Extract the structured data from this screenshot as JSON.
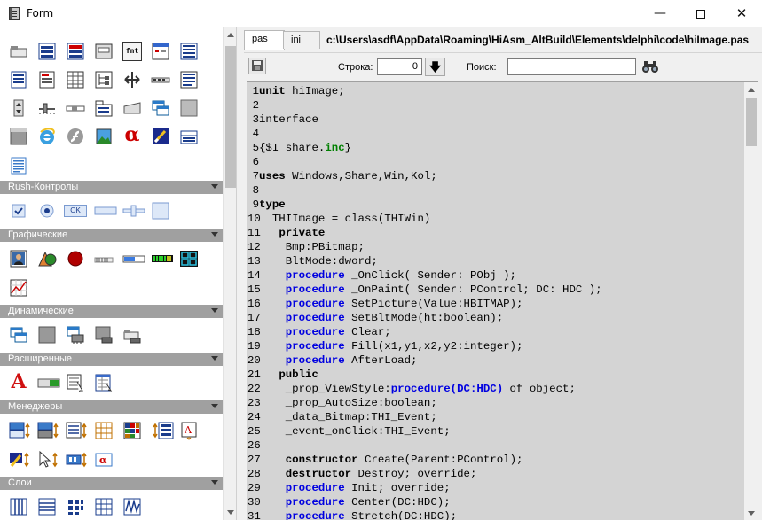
{
  "window": {
    "title": "Form"
  },
  "palette": {
    "categories": [
      {
        "label": "Rush-Контролы"
      },
      {
        "label": "Графические"
      },
      {
        "label": "Динамические"
      },
      {
        "label": "Расширенные"
      },
      {
        "label": "Менеджеры"
      },
      {
        "label": "Слои"
      }
    ],
    "fnt_icon_text": "fnt",
    "ok_icon_text": "OK",
    "alpha_glyph": "α"
  },
  "editor": {
    "tabs": [
      {
        "label": "pas"
      },
      {
        "label": "ini"
      }
    ],
    "file_path": "c:\\Users\\asdf\\AppData\\Roaming\\HiAsm_AltBuild\\Elements\\delphi\\code\\hiImage.pas",
    "line_label": "Строка:",
    "line_value": "0",
    "search_label": "Поиск:",
    "search_value": "",
    "code_lines": [
      [
        [
          "kw",
          "unit"
        ],
        [
          "t",
          " hiImage;"
        ]
      ],
      [],
      [
        [
          "t",
          "interface"
        ]
      ],
      [],
      [
        [
          "t",
          "{$I share."
        ],
        [
          "dr",
          "inc"
        ],
        [
          "t",
          "}"
        ]
      ],
      [],
      [
        [
          "kw",
          "uses"
        ],
        [
          "t",
          " Windows,Share,Win,Kol;"
        ]
      ],
      [],
      [
        [
          "kw",
          "type"
        ]
      ],
      [
        [
          "t",
          "  THIImage = class(THIWin)"
        ]
      ],
      [
        [
          "t",
          "   "
        ],
        [
          "kw",
          "private"
        ]
      ],
      [
        [
          "t",
          "    Bmp:PBitmap;"
        ]
      ],
      [
        [
          "t",
          "    BltMode:dword;"
        ]
      ],
      [
        [
          "t",
          "    "
        ],
        [
          "pk",
          "procedure"
        ],
        [
          "t",
          " _OnClick( Sender: PObj );"
        ]
      ],
      [
        [
          "t",
          "    "
        ],
        [
          "pk",
          "procedure"
        ],
        [
          "t",
          " _OnPaint( Sender: PControl; DC: HDC );"
        ]
      ],
      [
        [
          "t",
          "    "
        ],
        [
          "pk",
          "procedure"
        ],
        [
          "t",
          " SetPicture(Value:HBITMAP);"
        ]
      ],
      [
        [
          "t",
          "    "
        ],
        [
          "pk",
          "procedure"
        ],
        [
          "t",
          " SetBltMode(ht:boolean);"
        ]
      ],
      [
        [
          "t",
          "    "
        ],
        [
          "pk",
          "procedure"
        ],
        [
          "t",
          " Clear;"
        ]
      ],
      [
        [
          "t",
          "    "
        ],
        [
          "pk",
          "procedure"
        ],
        [
          "t",
          " Fill(x1,y1,x2,y2:integer);"
        ]
      ],
      [
        [
          "t",
          "    "
        ],
        [
          "pk",
          "procedure"
        ],
        [
          "t",
          " AfterLoad;"
        ]
      ],
      [
        [
          "t",
          "   "
        ],
        [
          "kw",
          "public"
        ]
      ],
      [
        [
          "t",
          "    _prop_ViewStyle:"
        ],
        [
          "pk",
          "procedure(DC:HDC)"
        ],
        [
          "t",
          " of object;"
        ]
      ],
      [
        [
          "t",
          "    _prop_AutoSize:boolean;"
        ]
      ],
      [
        [
          "t",
          "    _data_Bitmap:THI_Event;"
        ]
      ],
      [
        [
          "t",
          "    _event_onClick:THI_Event;"
        ]
      ],
      [],
      [
        [
          "t",
          "    "
        ],
        [
          "kw",
          "constructor"
        ],
        [
          "t",
          " Create(Parent:PControl);"
        ]
      ],
      [
        [
          "t",
          "    "
        ],
        [
          "kw",
          "destructor"
        ],
        [
          "t",
          " Destroy; override;"
        ]
      ],
      [
        [
          "t",
          "    "
        ],
        [
          "pk",
          "procedure"
        ],
        [
          "t",
          " Init; override;"
        ]
      ],
      [
        [
          "t",
          "    "
        ],
        [
          "pk",
          "procedure"
        ],
        [
          "t",
          " Center(DC:HDC);"
        ]
      ],
      [
        [
          "t",
          "    "
        ],
        [
          "pk",
          "procedure"
        ],
        [
          "t",
          " Stretch(DC:HDC);"
        ]
      ]
    ]
  }
}
